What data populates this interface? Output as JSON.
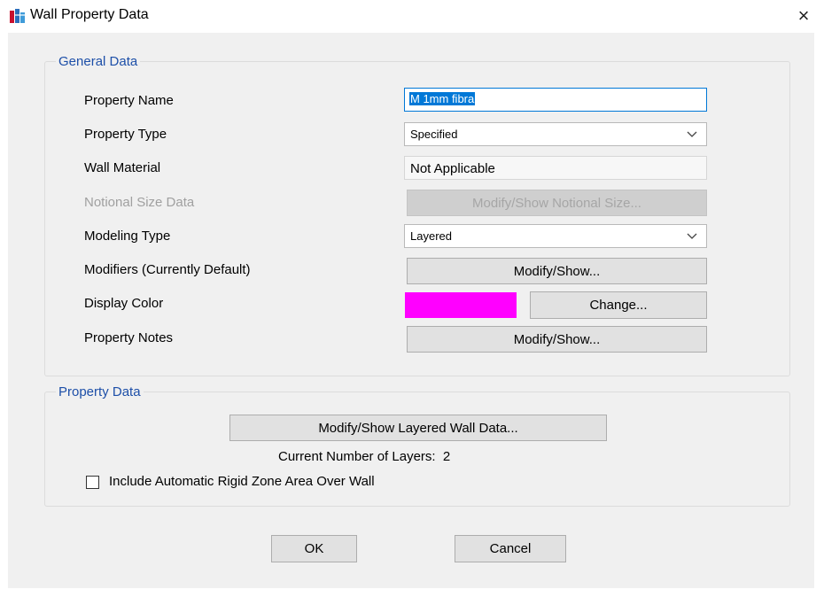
{
  "window": {
    "title": "Wall Property Data",
    "close_glyph": "×"
  },
  "general_data": {
    "legend": "General Data",
    "property_name_label": "Property Name",
    "property_name_value": "M 1mm fibra",
    "property_type_label": "Property Type",
    "property_type_value": "Specified",
    "wall_material_label": "Wall Material",
    "wall_material_value": "Not Applicable",
    "notional_size_label": "Notional Size Data",
    "notional_size_button": "Modify/Show Notional Size...",
    "modeling_type_label": "Modeling Type",
    "modeling_type_value": "Layered",
    "modifiers_label": "Modifiers (Currently Default)",
    "modifiers_button": "Modify/Show...",
    "display_color_label": "Display Color",
    "display_color_hex": "#ff00ff",
    "change_button": "Change...",
    "property_notes_label": "Property Notes",
    "property_notes_button": "Modify/Show..."
  },
  "property_data": {
    "legend": "Property Data",
    "layered_button": "Modify/Show Layered Wall Data...",
    "layers_text": "Current Number of Layers:  2",
    "rigid_zone_label": "Include Automatic Rigid Zone Area Over Wall",
    "rigid_zone_checked": false
  },
  "footer": {
    "ok": "OK",
    "cancel": "Cancel"
  },
  "colors": {
    "legend": "#1d4fa8",
    "focus": "#0078d7",
    "dialog_bg": "#f0f0f0"
  }
}
